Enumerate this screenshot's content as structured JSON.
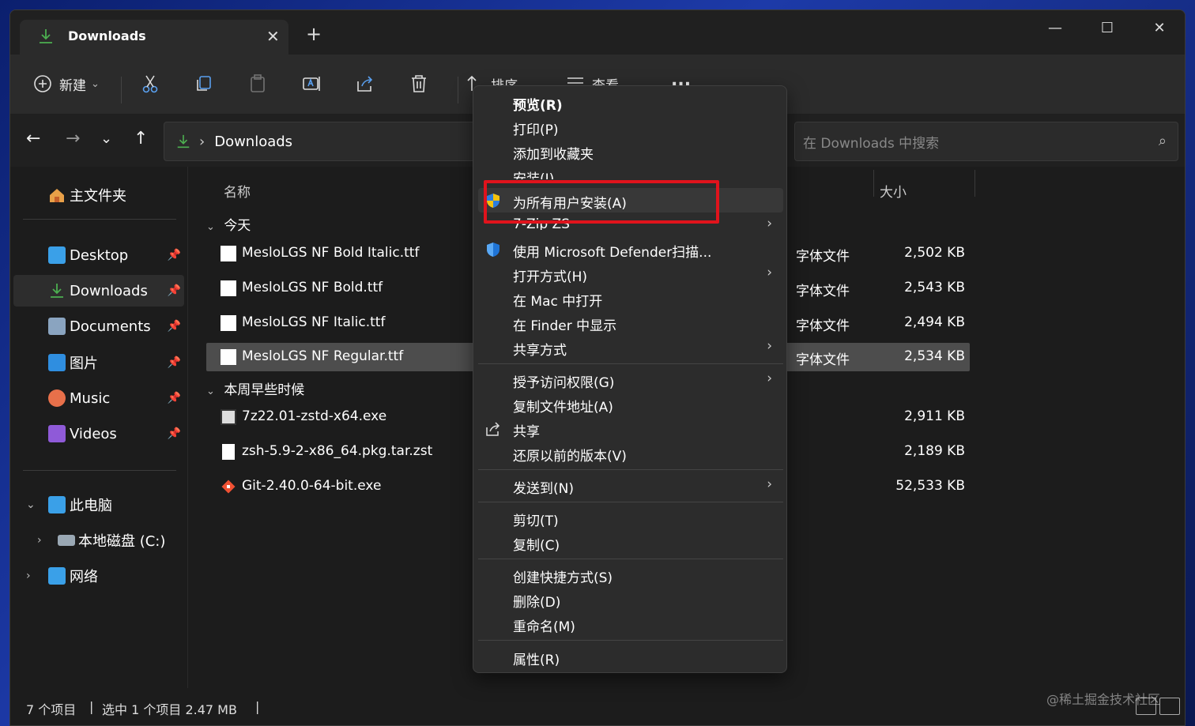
{
  "tab": {
    "title": "Downloads",
    "close": "✕",
    "new_tab": "+"
  },
  "window_controls": {
    "minimize": "—",
    "maximize": "☐",
    "close": "✕"
  },
  "toolbar": {
    "new_label": "新建",
    "new_chevron": "⌄",
    "sort_label": "排序",
    "view_label": "查看",
    "more": "..."
  },
  "nav": {
    "back": "←",
    "forward": "→",
    "recent": "⌄",
    "up": "↑"
  },
  "address": {
    "sep": "›",
    "path": "Downloads"
  },
  "search": {
    "placeholder": "在 Downloads 中搜索"
  },
  "sidebar": {
    "home": "主文件夹",
    "items": [
      {
        "label": "Desktop",
        "color": "#3aa0e8"
      },
      {
        "label": "Downloads",
        "color": "#4caf50"
      },
      {
        "label": "Documents",
        "color": "#8aa4c0"
      },
      {
        "label": "图片",
        "color": "#2f8ee0"
      },
      {
        "label": "Music",
        "color": "#e8704a"
      },
      {
        "label": "Videos",
        "color": "#8f5ad8"
      }
    ],
    "pin": "📌",
    "this_pc": "此电脑",
    "local_disk": "本地磁盘 (C:)",
    "network": "网络"
  },
  "columns": {
    "name": "名称",
    "size": "大小"
  },
  "groups": {
    "today": "今天",
    "earlier": "本周早些时候",
    "chevron": "⌄"
  },
  "files": [
    {
      "name": "MesloLGS NF Bold Italic.ttf",
      "type": "字体文件",
      "size": "2,502 KB"
    },
    {
      "name": "MesloLGS NF Bold.ttf",
      "type": "字体文件",
      "size": "2,543 KB"
    },
    {
      "name": "MesloLGS NF Italic.ttf",
      "type": "字体文件",
      "size": "2,494 KB"
    },
    {
      "name": "MesloLGS NF Regular.ttf",
      "type": "字体文件",
      "size": "2,534 KB"
    },
    {
      "name": "7z22.01-zstd-x64.exe",
      "type": "",
      "size": "2,911 KB"
    },
    {
      "name": "zsh-5.9-2-x86_64.pkg.tar.zst",
      "type": "",
      "size": "2,189 KB"
    },
    {
      "name": "Git-2.40.0-64-bit.exe",
      "type": "",
      "size": "52,533 KB"
    }
  ],
  "status": {
    "count": "7 个项目",
    "sep": "|",
    "selection": "选中 1 个项目  2.47 MB",
    "sep2": "|"
  },
  "context_menu": {
    "arrow": "›",
    "items": [
      "预览(R)",
      "打印(P)",
      "添加到收藏夹",
      "安装(I)",
      "为所有用户安装(A)",
      "7-Zip ZS",
      "使用 Microsoft Defender扫描...",
      "打开方式(H)",
      "在 Mac 中打开",
      "在 Finder 中显示",
      "共享方式",
      "授予访问权限(G)",
      "复制文件地址(A)",
      "共享",
      "还原以前的版本(V)",
      "发送到(N)",
      "剪切(T)",
      "复制(C)",
      "创建快捷方式(S)",
      "删除(D)",
      "重命名(M)",
      "属性(R)"
    ]
  },
  "watermark": "@稀土掘金技术社区",
  "colors": {
    "highlight": "#e0131c",
    "selected_row": "#4d4d4d",
    "menu_bg": "#2c2c2c"
  }
}
